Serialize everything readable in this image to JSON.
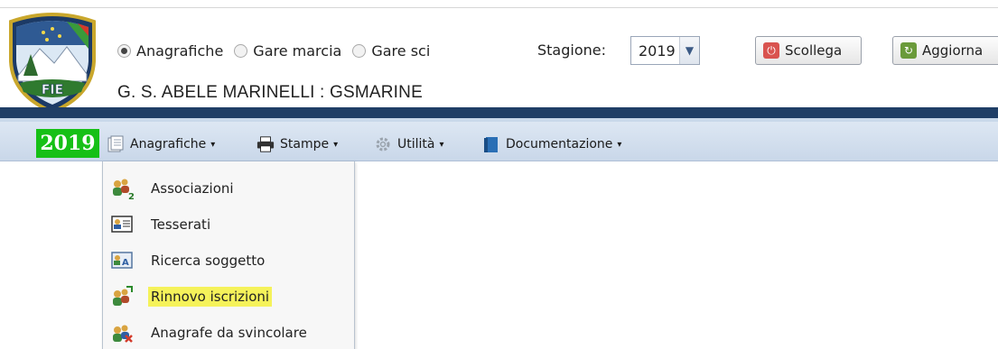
{
  "header": {
    "logo_text": "FIE",
    "mode_options": [
      {
        "label": "Anagrafiche",
        "checked": true
      },
      {
        "label": "Gare marcia",
        "checked": false
      },
      {
        "label": "Gare sci",
        "checked": false
      }
    ],
    "season_label": "Stagione:",
    "season_value": "2019",
    "disconnect_label": "Scollega",
    "refresh_label": "Aggiorna",
    "company": "G. S. ABELE MARINELLI : GSMARINE"
  },
  "menubar": {
    "year": "2019",
    "items": [
      {
        "label": "Anagrafiche",
        "icon": "registry-icon",
        "caret": "▾"
      },
      {
        "label": "Stampe",
        "icon": "printer-icon",
        "caret": "▾"
      },
      {
        "label": "Utilità",
        "icon": "gear-icon",
        "caret": "▾"
      },
      {
        "label": "Documentazione",
        "icon": "book-icon",
        "caret": "▾"
      }
    ]
  },
  "dropdown": {
    "items": [
      {
        "label": "Associazioni",
        "icon": "associations-icon",
        "highlighted": false
      },
      {
        "label": "Tesserati",
        "icon": "member-card-icon",
        "highlighted": false
      },
      {
        "label": "Ricerca soggetto",
        "icon": "search-subject-icon",
        "highlighted": false
      },
      {
        "label": "Rinnovo iscrizioni",
        "icon": "renewal-icon",
        "highlighted": true
      },
      {
        "label": "Anagrafe da svincolare",
        "icon": "release-icon",
        "highlighted": false
      }
    ]
  },
  "colors": {
    "navy": "#1f3e66",
    "year_badge": "#16c016",
    "highlight": "#f5f25a",
    "disconnect": "#d9534f"
  }
}
